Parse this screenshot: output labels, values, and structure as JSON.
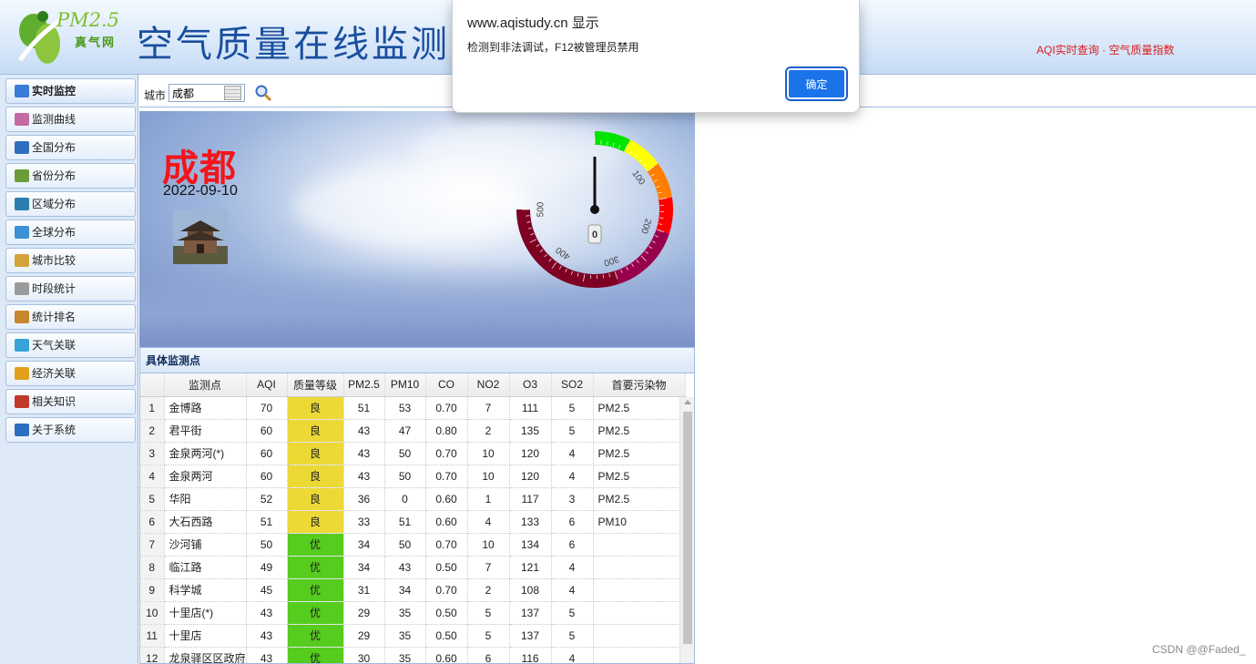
{
  "header": {
    "logo_pm": "PM2.5",
    "logo_sub": "真气网",
    "site_title": "空气质量在线监测",
    "right_text": "AQI实时查询 · 空气质量指数"
  },
  "sidebar": {
    "items": [
      {
        "label": "实时监控",
        "icon": "monitor-icon",
        "active": true
      },
      {
        "label": "监测曲线",
        "icon": "line-chart-icon"
      },
      {
        "label": "全国分布",
        "icon": "map-icon"
      },
      {
        "label": "省份分布",
        "icon": "province-map-icon"
      },
      {
        "label": "区域分布",
        "icon": "region-map-icon"
      },
      {
        "label": "全球分布",
        "icon": "globe-icon"
      },
      {
        "label": "城市比较",
        "icon": "compare-icon"
      },
      {
        "label": "时段统计",
        "icon": "clock-icon"
      },
      {
        "label": "统计排名",
        "icon": "ranking-icon"
      },
      {
        "label": "天气关联",
        "icon": "weather-icon"
      },
      {
        "label": "经济关联",
        "icon": "coin-icon"
      },
      {
        "label": "相关知识",
        "icon": "book-icon"
      },
      {
        "label": "关于系统",
        "icon": "info-icon"
      }
    ]
  },
  "search": {
    "label": "城市",
    "value": "成都"
  },
  "banner": {
    "city": "成都",
    "date": "2022-09-10",
    "gauge": {
      "value_label": "0",
      "ticks": [
        "100",
        "200",
        "300",
        "400",
        "500"
      ],
      "max": 500,
      "needle_value": 0,
      "band_colors": [
        "#00e400",
        "#ffff00",
        "#ff7e00",
        "#ff0000",
        "#99004c",
        "#7e0023"
      ]
    }
  },
  "stations": {
    "title": "具体监测点",
    "columns": [
      "监测点",
      "AQI",
      "质量等级",
      "PM2.5",
      "PM10",
      "CO",
      "NO2",
      "O3",
      "SO2",
      "首要污染物"
    ],
    "rows": [
      {
        "n": "1",
        "name": "金博路",
        "aqi": "70",
        "level": "良",
        "pm25": "51",
        "pm10": "53",
        "co": "0.70",
        "no2": "7",
        "o3": "111",
        "so2": "5",
        "primary": "PM2.5"
      },
      {
        "n": "2",
        "name": "君平街",
        "aqi": "60",
        "level": "良",
        "pm25": "43",
        "pm10": "47",
        "co": "0.80",
        "no2": "2",
        "o3": "135",
        "so2": "5",
        "primary": "PM2.5"
      },
      {
        "n": "3",
        "name": "金泉两河(*)",
        "aqi": "60",
        "level": "良",
        "pm25": "43",
        "pm10": "50",
        "co": "0.70",
        "no2": "10",
        "o3": "120",
        "so2": "4",
        "primary": "PM2.5"
      },
      {
        "n": "4",
        "name": "金泉两河",
        "aqi": "60",
        "level": "良",
        "pm25": "43",
        "pm10": "50",
        "co": "0.70",
        "no2": "10",
        "o3": "120",
        "so2": "4",
        "primary": "PM2.5"
      },
      {
        "n": "5",
        "name": "华阳",
        "aqi": "52",
        "level": "良",
        "pm25": "36",
        "pm10": "0",
        "co": "0.60",
        "no2": "1",
        "o3": "117",
        "so2": "3",
        "primary": "PM2.5"
      },
      {
        "n": "6",
        "name": "大石西路",
        "aqi": "51",
        "level": "良",
        "pm25": "33",
        "pm10": "51",
        "co": "0.60",
        "no2": "4",
        "o3": "133",
        "so2": "6",
        "primary": "PM10"
      },
      {
        "n": "7",
        "name": "沙河铺",
        "aqi": "50",
        "level": "优",
        "pm25": "34",
        "pm10": "50",
        "co": "0.70",
        "no2": "10",
        "o3": "134",
        "so2": "6",
        "primary": ""
      },
      {
        "n": "8",
        "name": "临江路",
        "aqi": "49",
        "level": "优",
        "pm25": "34",
        "pm10": "43",
        "co": "0.50",
        "no2": "7",
        "o3": "121",
        "so2": "4",
        "primary": ""
      },
      {
        "n": "9",
        "name": "科学城",
        "aqi": "45",
        "level": "优",
        "pm25": "31",
        "pm10": "34",
        "co": "0.70",
        "no2": "2",
        "o3": "108",
        "so2": "4",
        "primary": ""
      },
      {
        "n": "10",
        "name": "十里店(*)",
        "aqi": "43",
        "level": "优",
        "pm25": "29",
        "pm10": "35",
        "co": "0.50",
        "no2": "5",
        "o3": "137",
        "so2": "5",
        "primary": ""
      },
      {
        "n": "11",
        "name": "十里店",
        "aqi": "43",
        "level": "优",
        "pm25": "29",
        "pm10": "35",
        "co": "0.50",
        "no2": "5",
        "o3": "137",
        "so2": "5",
        "primary": ""
      },
      {
        "n": "12",
        "name": "龙泉驿区区政府",
        "aqi": "43",
        "level": "优",
        "pm25": "30",
        "pm10": "35",
        "co": "0.60",
        "no2": "6",
        "o3": "116",
        "so2": "4",
        "primary": ""
      }
    ],
    "level_colors": {
      "良": "#ecd935",
      "优": "#56cc1e"
    }
  },
  "alert": {
    "origin": "www.aqistudy.cn 显示",
    "message": "检测到非法调试，F12被管理员禁用",
    "ok_label": "确定"
  },
  "watermark": "CSDN @@Faded_"
}
